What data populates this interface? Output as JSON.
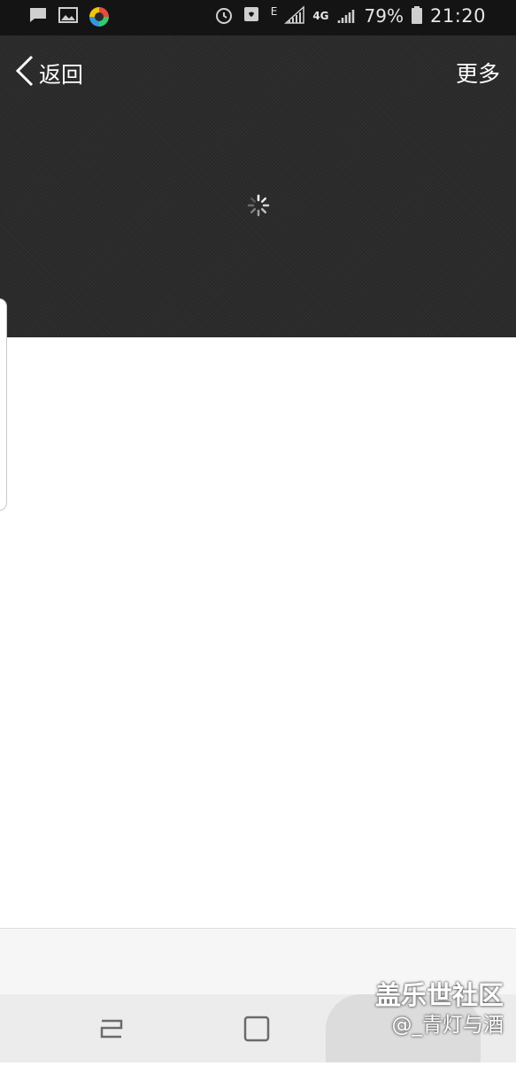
{
  "status_bar": {
    "battery": "79%",
    "time": "21:20",
    "network": "4G",
    "edge": "E",
    "icons": [
      "message-icon",
      "gallery-icon",
      "app-icon",
      "alarm-icon",
      "nfc-icon",
      "signal-icon",
      "signal-icon",
      "battery-icon"
    ]
  },
  "header": {
    "back_label": "返回",
    "more_label": "更多"
  },
  "watermark": {
    "line1": "盖乐世社区",
    "line2": "@_青灯与酒"
  },
  "colors": {
    "header_bg": "#2a2a2a",
    "status_bg": "#141414",
    "nav_bg": "#ececec"
  }
}
